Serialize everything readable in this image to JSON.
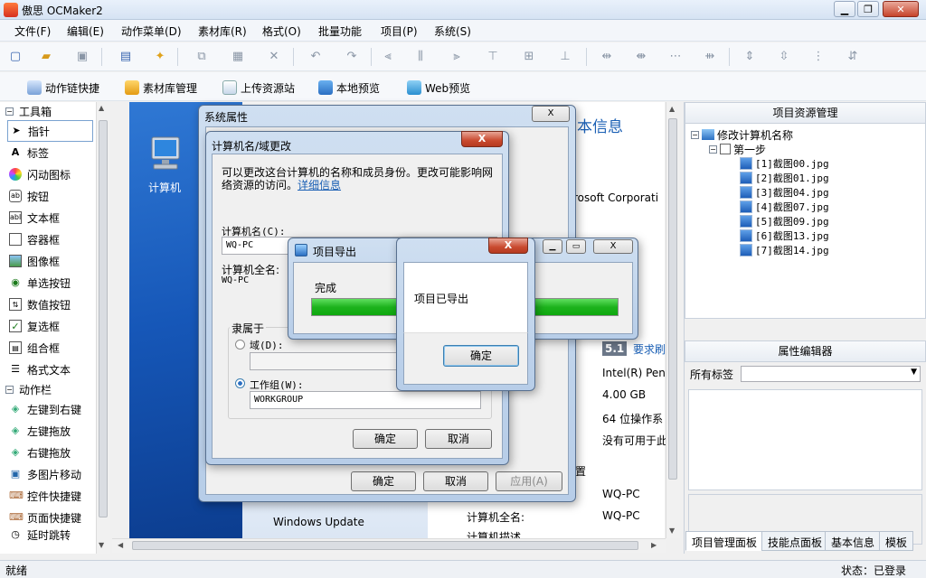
{
  "app": {
    "title": "傲思 OCMaker2",
    "min": "▁",
    "max": "❐",
    "close": "✕"
  },
  "menu": [
    "文件(F)",
    "编辑(E)",
    "动作菜单(D)",
    "素材库(R)",
    "格式(O)",
    "批量功能",
    "项目(P)",
    "系统(S)"
  ],
  "quickbar": [
    "动作链快捷",
    "素材库管理",
    "上传资源站",
    "本地预览",
    "Web预览"
  ],
  "toolbox": {
    "header": "工具箱",
    "items": [
      "指针",
      "标签",
      "闪动图标",
      "按钮",
      "文本框",
      "容器框",
      "图像框",
      "单选按钮",
      "数值按钮",
      "复选框",
      "组合框",
      "格式文本"
    ],
    "icons": [
      "arrow-pointer-icon",
      "label-a-icon",
      "flash-icon",
      "button-icon",
      "textbox-icon",
      "container-icon",
      "image-icon",
      "radio-icon",
      "spin-icon",
      "checkbox-icon",
      "combo-icon",
      "richtext-icon"
    ]
  },
  "actionbar": {
    "header": "动作栏",
    "items": [
      "左键到右键",
      "左键拖放",
      "右键拖放",
      "多图片移动",
      "控件快捷键",
      "页面快捷键",
      "延时跳转"
    ]
  },
  "desktop": {
    "computer_label": "计算机"
  },
  "bgwin": {
    "heading": "本信息",
    "corp": "rosoft Corporati",
    "score": "5.1",
    "score_link": "要求刷",
    "cpu": "Intel(R) Pen",
    "ram": "4.00 GB",
    "os": "64 位操作系",
    "pen": "没有可用于此",
    "settings": "置",
    "pc1": "WQ-PC",
    "pc2": "WQ-PC",
    "fullname_label": "计算机全名:",
    "desc_label": "计算机描述",
    "wu": "Windows Update"
  },
  "sysprops": {
    "title": "系统属性",
    "ok": "确定",
    "cancel": "取消",
    "apply": "应用(A)",
    "close": "X"
  },
  "rename": {
    "title": "计算机名/域更改",
    "desc": "可以更改这台计算机的名称和成员身份。更改可能影响网络资源的访问。",
    "link": "详细信息",
    "name_label": "计算机名(C):",
    "name_value": "WQ-PC",
    "full_label": "计算机全名:",
    "full_value": "WQ-PC",
    "member_label": "隶属于",
    "domain_label": "域(D):",
    "workgroup_label": "工作组(W):",
    "workgroup_value": "WORKGROUP",
    "ok": "确定",
    "cancel": "取消",
    "close": "X"
  },
  "export": {
    "title": "项目导出",
    "status": "完成",
    "progress": 1.0,
    "close": "X"
  },
  "msgbox": {
    "text": "项目已导出",
    "ok": "确定",
    "close": "X"
  },
  "resources": {
    "header": "项目资源管理",
    "root": "修改计算机名称",
    "step": "第一步",
    "files": [
      "[1]截图00.jpg",
      "[2]截图01.jpg",
      "[3]截图04.jpg",
      "[4]截图07.jpg",
      "[5]截图09.jpg",
      "[6]截图13.jpg",
      "[7]截图14.jpg"
    ]
  },
  "props": {
    "header": "属性编辑器",
    "all_tags": "所有标签"
  },
  "tabs": [
    "项目管理面板",
    "技能点面板",
    "基本信息",
    "模板"
  ],
  "status": {
    "left": "就绪",
    "right": "状态：已登录"
  },
  "colors": {
    "accent": "#1a5fb4",
    "progress": "#1db31d",
    "desktop": "#1657b8"
  }
}
